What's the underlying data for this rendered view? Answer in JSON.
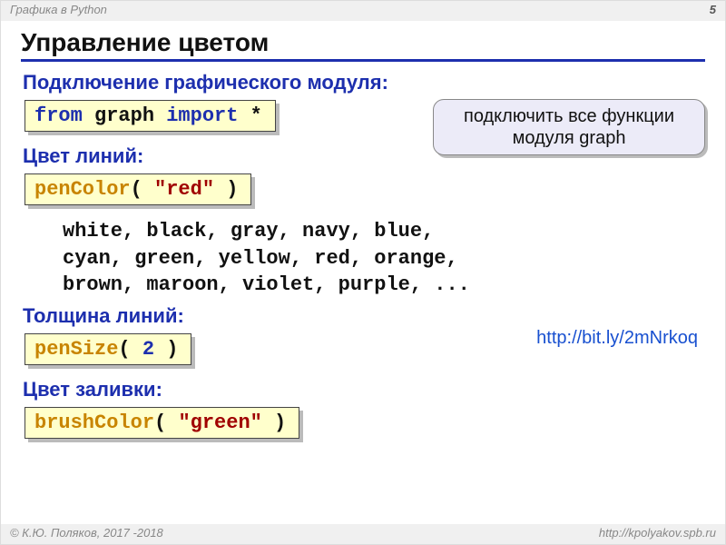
{
  "header": {
    "left": "Графика в Python",
    "pagenum": "5"
  },
  "footer": {
    "left": "© К.Ю. Поляков, 2017 -2018",
    "right": "http://kpolyakov.spb.ru"
  },
  "title": "Управление цветом",
  "section1": "Подключение графического модуля:",
  "code1": {
    "kw1": "from",
    "mod": " graph ",
    "kw2": "import",
    "rest": " *"
  },
  "callout": "подключить все функции модуля graph",
  "section2": "Цвет линий:",
  "code2": {
    "fn": "penColor",
    "open": "( ",
    "arg": "\"red\"",
    "close": " )"
  },
  "colors_l1": "white, black, gray, navy, blue,",
  "colors_l2": "cyan, green, yellow, red, orange,",
  "colors_l3": "brown, maroon, violet, purple, ...",
  "section3": "Толщина линий:",
  "link": "http://bit.ly/2mNrkoq",
  "code3": {
    "fn": "penSize",
    "open": "( ",
    "arg": "2",
    "close": " )"
  },
  "section4": "Цвет заливки:",
  "code4": {
    "fn": "brushColor",
    "open": "( ",
    "arg": "\"green\"",
    "close": " )"
  }
}
